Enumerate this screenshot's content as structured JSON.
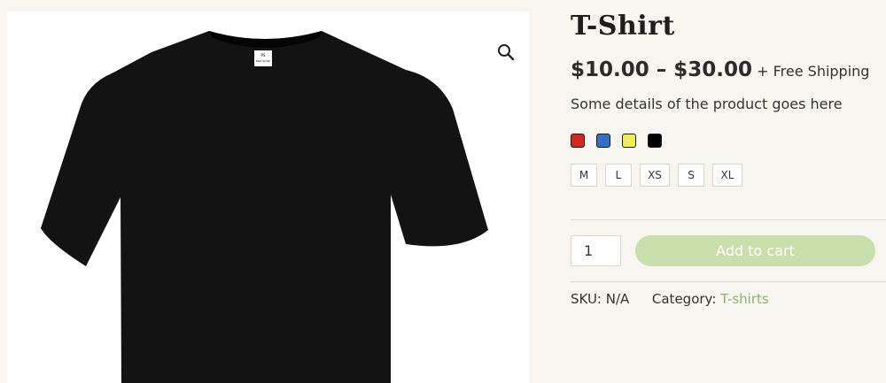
{
  "product": {
    "title": "T-Shirt",
    "price_range": "$10.00 – $30.00",
    "shipping_note": "+ Free Shipping",
    "description": "Some details of the product goes here",
    "colors": [
      {
        "name": "red",
        "hex": "#d2281f"
      },
      {
        "name": "blue",
        "hex": "#3170c4"
      },
      {
        "name": "yellow",
        "hex": "#eeee55"
      },
      {
        "name": "black",
        "hex": "#000000"
      }
    ],
    "sizes": [
      "M",
      "L",
      "XS",
      "S",
      "XL"
    ],
    "quantity": "1",
    "add_to_cart_label": "Add to cart",
    "sku_label": "SKU:",
    "sku_value": "N/A",
    "category_label": "Category:",
    "category_value": "T-shirts",
    "image_icon": "zoom-search-icon",
    "shirt_label_lines": [
      "PS",
      "Paul Smith"
    ]
  },
  "theme": {
    "background": "#f6f5f0",
    "cart_button": "#c8deab",
    "link_color": "#8fb26a"
  }
}
